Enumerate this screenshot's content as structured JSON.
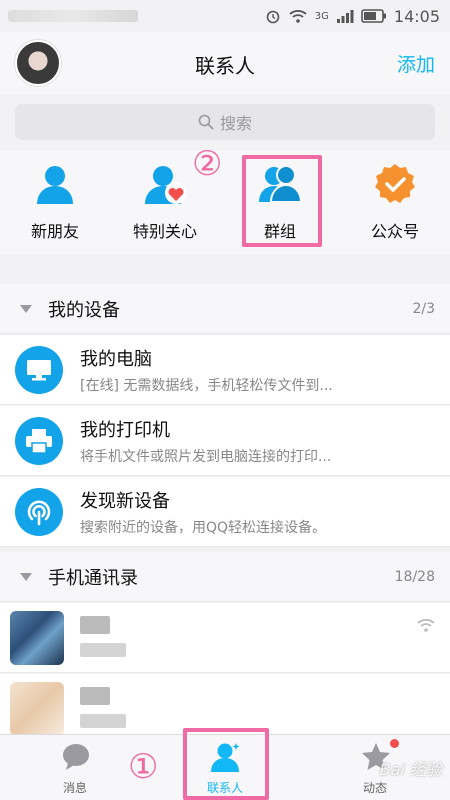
{
  "status_bar": {
    "time": "14:05",
    "network": "3G",
    "icons": [
      "alarm-icon",
      "wifi-icon",
      "signal-icon",
      "battery-icon"
    ]
  },
  "header": {
    "title": "联系人",
    "add_label": "添加"
  },
  "search": {
    "placeholder": "搜索"
  },
  "quick_actions": [
    {
      "label": "新朋友",
      "icon": "new-friend-icon"
    },
    {
      "label": "特别关心",
      "icon": "special-care-icon"
    },
    {
      "label": "群组",
      "icon": "group-icon"
    },
    {
      "label": "公众号",
      "icon": "official-account-icon"
    }
  ],
  "annotations": {
    "one": "①",
    "two": "②"
  },
  "my_devices": {
    "title": "我的设备",
    "count": "2/3",
    "items": [
      {
        "title": "我的电脑",
        "subtitle": "[在线] 无需数据线，手机轻松传文件到...",
        "icon": "computer-icon"
      },
      {
        "title": "我的打印机",
        "subtitle": "将手机文件或照片发到电脑连接的打印...",
        "icon": "printer-icon"
      },
      {
        "title": "发现新设备",
        "subtitle": "搜索附近的设备，用QQ轻松连接设备。",
        "icon": "radar-icon"
      }
    ]
  },
  "phone_contacts": {
    "title": "手机通讯录",
    "count": "18/28"
  },
  "tabs": [
    {
      "label": "消息",
      "icon": "message-icon",
      "active": false
    },
    {
      "label": "联系人",
      "icon": "contacts-icon",
      "active": true
    },
    {
      "label": "动态",
      "icon": "feeds-icon",
      "active": false
    }
  ],
  "watermark": "Bai 经验",
  "colors": {
    "accent": "#12b7f5",
    "highlight": "#f06aa4",
    "icon_blue": "#13a3e8",
    "badge_red": "#f24e4e",
    "orange": "#f5922f"
  }
}
